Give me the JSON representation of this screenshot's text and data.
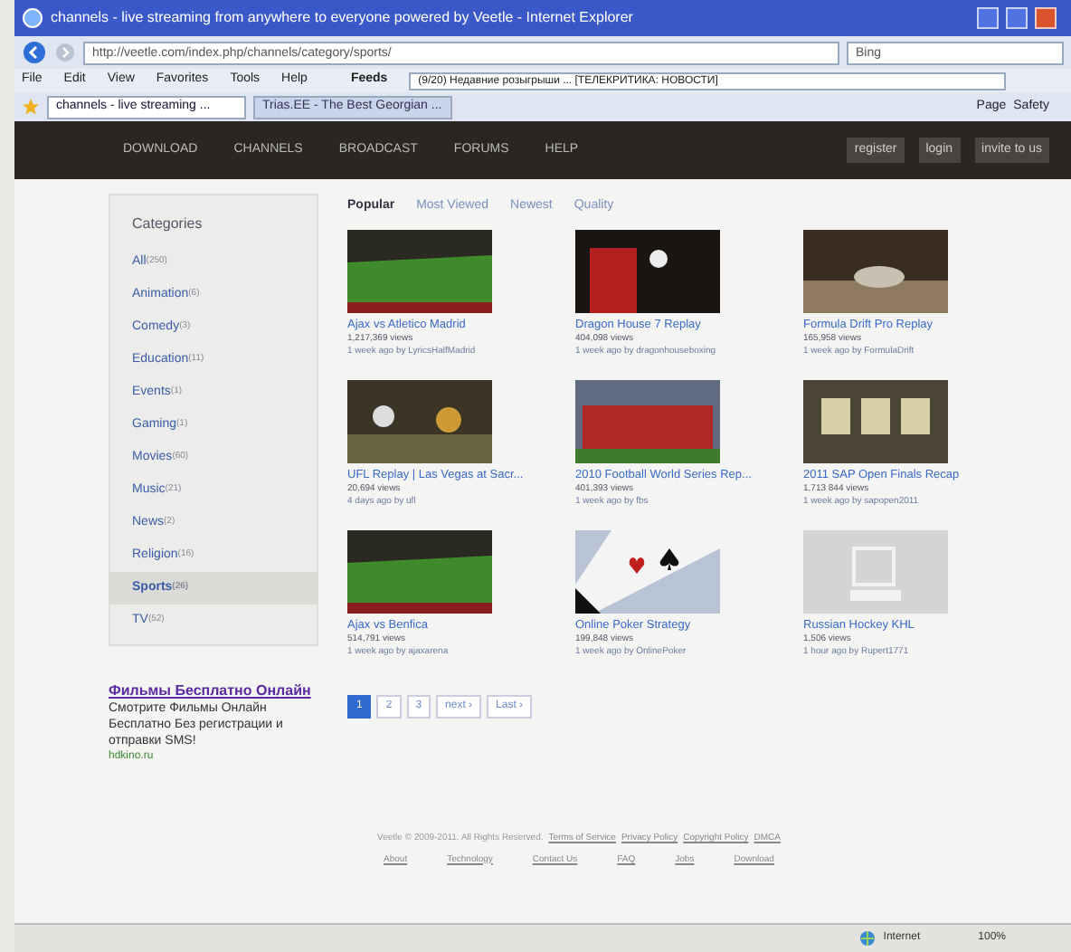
{
  "window": {
    "title": "channels - live streaming from anywhere to everyone powered by Veetle - Internet Explorer"
  },
  "address_bar": {
    "url": "http://veetle.com/index.php/channels/category/sports/",
    "search": "Bing"
  },
  "menu": [
    "File",
    "Edit",
    "View",
    "Favorites",
    "Tools",
    "Help"
  ],
  "feeds": {
    "label": "Feeds",
    "text": "(9/20) Недавние розыгрыши ... [ТЕЛЕКРИТИКА: НОВОСТИ]"
  },
  "browser_tabs": [
    {
      "label": "channels - live streaming ...",
      "selected": true
    },
    {
      "label": "Trias.EE - The Best Georgian ...",
      "selected": false
    }
  ],
  "toolbar": {
    "page": "Page",
    "safety": "Safety"
  },
  "nav": [
    "DOWNLOAD",
    "CHANNELS",
    "BROADCAST",
    "FORUMS",
    "HELP"
  ],
  "account": [
    "register",
    "login",
    "invite to us"
  ],
  "categories": {
    "title": "Categories",
    "items": [
      {
        "name": "All",
        "count": "(250)",
        "selected": false
      },
      {
        "name": "Animation",
        "count": "(6)",
        "selected": false
      },
      {
        "name": "Comedy",
        "count": "(3)",
        "selected": false
      },
      {
        "name": "Education",
        "count": "(11)",
        "selected": false
      },
      {
        "name": "Events",
        "count": "(1)",
        "selected": false
      },
      {
        "name": "Gaming",
        "count": "(1)",
        "selected": false
      },
      {
        "name": "Movies",
        "count": "(60)",
        "selected": false
      },
      {
        "name": "Music",
        "count": "(21)",
        "selected": false
      },
      {
        "name": "News",
        "count": "(2)",
        "selected": false
      },
      {
        "name": "Religion",
        "count": "(16)",
        "selected": false
      },
      {
        "name": "Sports",
        "count": "(26)",
        "selected": true
      },
      {
        "name": "TV",
        "count": "(52)",
        "selected": false
      }
    ]
  },
  "ad": {
    "title": "Фильмы Бесплатно Онлайн",
    "text": "Смотрите Фильмы Онлайн Бесплатно Без регистрации и отправки SMS!",
    "url": "hdkino.ru"
  },
  "sort_tabs": [
    {
      "label": "Popular",
      "selected": true
    },
    {
      "label": "Most Viewed",
      "selected": false
    },
    {
      "label": "Newest",
      "selected": false
    },
    {
      "label": "Quality",
      "selected": false
    }
  ],
  "videos": [
    {
      "title": "Ajax vs Atletico Madrid",
      "views": "1,217,369 views",
      "meta": "1 week ago by LyricsHalfMadrid",
      "kind": "field"
    },
    {
      "title": "Dragon House 7 Replay",
      "views": "404,098 views",
      "meta": "1 week ago by dragonhouseboxing",
      "kind": "boxing"
    },
    {
      "title": "Formula Drift Pro Replay",
      "views": "165,958 views",
      "meta": "1 week ago by FormulaDrift",
      "kind": "car"
    },
    {
      "title": "UFL Replay | Las Vegas at Sacr...",
      "views": "20,694 views",
      "meta": "4 days ago by ufl",
      "kind": "crowd"
    },
    {
      "title": "2010 Football World Series Rep...",
      "views": "401,393 views",
      "meta": "1 week ago by fbs",
      "kind": "team"
    },
    {
      "title": "2011 SAP Open Finals Recap",
      "views": "1,713 844 views",
      "meta": "1 week ago by sapopen2011",
      "kind": "frames"
    },
    {
      "title": "Ajax vs Benfica",
      "views": "514,791 views",
      "meta": "1 week ago by ajaxarena",
      "kind": "field"
    },
    {
      "title": "Online Poker Strategy",
      "views": "199,848 views",
      "meta": "1 week ago by OnlinePoker",
      "kind": "cards"
    },
    {
      "title": "Russian Hockey KHL",
      "views": "1,506 views",
      "meta": "1 hour ago by Rupert1771",
      "kind": "none"
    }
  ],
  "pagination": [
    {
      "label": "1",
      "selected": true
    },
    {
      "label": "2",
      "selected": false
    },
    {
      "label": "3",
      "selected": false
    },
    {
      "label": "next ›",
      "selected": false
    },
    {
      "label": "Last ›",
      "selected": false
    }
  ],
  "footer": {
    "copyright": "Veetle © 2009-2011. All Rights Reserved.",
    "legal": [
      "Terms of Service",
      "Privacy Policy",
      "Copyright Policy",
      "DMCA"
    ],
    "links": [
      "About",
      "Technology",
      "Contact Us",
      "FAQ",
      "Jobs",
      "Download"
    ]
  },
  "status_bar": {
    "zone": "Internet",
    "zoom": "100%"
  }
}
